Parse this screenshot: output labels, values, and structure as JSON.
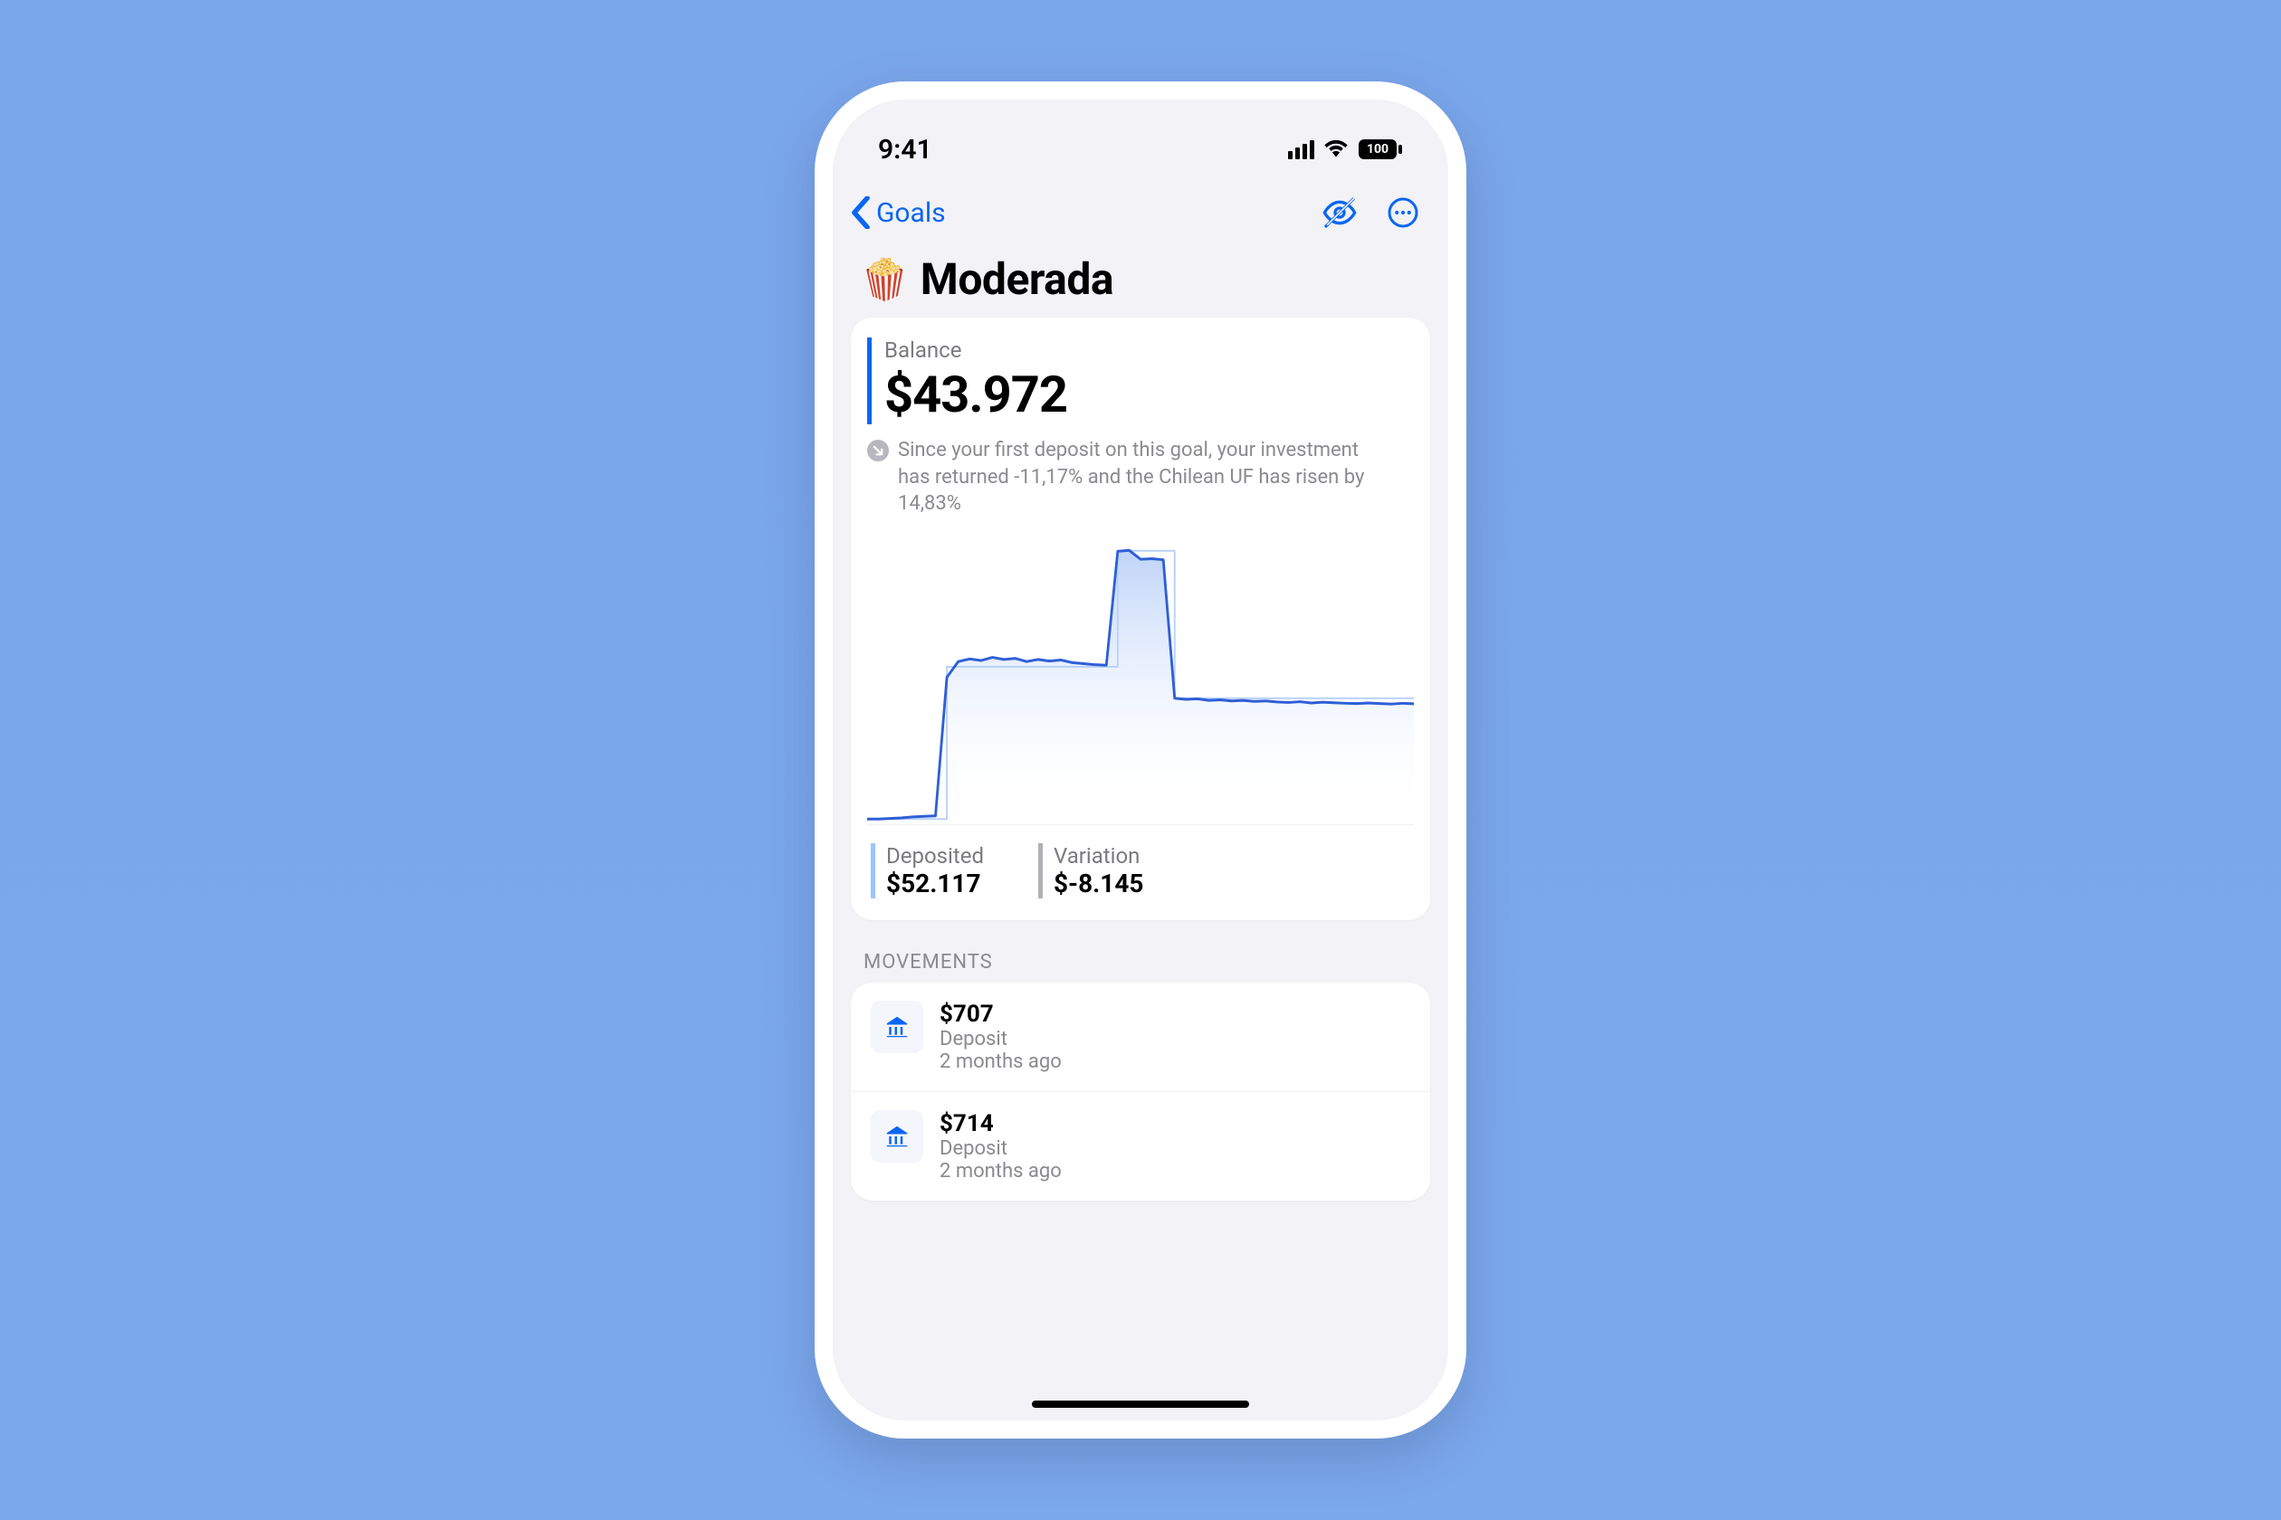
{
  "status": {
    "time": "9:41",
    "battery": "100"
  },
  "nav": {
    "back_label": "Goals"
  },
  "title": {
    "emoji": "🍿",
    "text": "Moderada"
  },
  "balance": {
    "label": "Balance",
    "amount": "$43.972",
    "info_text": "Since your first deposit on this goal, your investment has returned -11,17% and the Chilean UF has risen by 14,83%"
  },
  "metrics": {
    "deposited_label": "Deposited",
    "deposited_value": "$52.117",
    "variation_label": "Variation",
    "variation_value": "$-8.145"
  },
  "movements_header": "MOVEMENTS",
  "movements": [
    {
      "amount": "$707",
      "type": "Deposit",
      "time": "2 months ago"
    },
    {
      "amount": "$714",
      "type": "Deposit",
      "time": "2 months ago"
    }
  ],
  "colors": {
    "accent": "#0a66f2"
  },
  "chart_data": {
    "type": "line",
    "title": "",
    "xlabel": "",
    "ylabel": "",
    "ylim": [
      0,
      55000
    ],
    "series": [
      {
        "name": "balance",
        "values": [
          1000,
          1000,
          1100,
          1200,
          1400,
          1500,
          1600,
          28000,
          31000,
          31500,
          31200,
          31800,
          31400,
          31600,
          31000,
          31400,
          31100,
          31300,
          30800,
          30600,
          30400,
          30300,
          52000,
          52200,
          50500,
          50600,
          50400,
          24000,
          23800,
          23900,
          23600,
          23700,
          23500,
          23600,
          23400,
          23500,
          23300,
          23200,
          23350,
          23100,
          23250,
          23150,
          23050,
          23000,
          23100,
          23000,
          22900,
          23050,
          22950
        ]
      },
      {
        "name": "deposited",
        "values": [
          1000,
          1000,
          1000,
          1000,
          1000,
          1000,
          1000,
          30000,
          30000,
          30000,
          30000,
          30000,
          30000,
          30000,
          30000,
          30000,
          30000,
          30000,
          30000,
          30000,
          30000,
          30000,
          52117,
          52117,
          52117,
          52117,
          52117,
          24000,
          24000,
          24000,
          24000,
          24000,
          24000,
          24000,
          24000,
          24000,
          24000,
          24000,
          24000,
          24000,
          24000,
          24000,
          24000,
          24000,
          24000,
          24000,
          24000,
          24000,
          24000
        ]
      }
    ]
  }
}
